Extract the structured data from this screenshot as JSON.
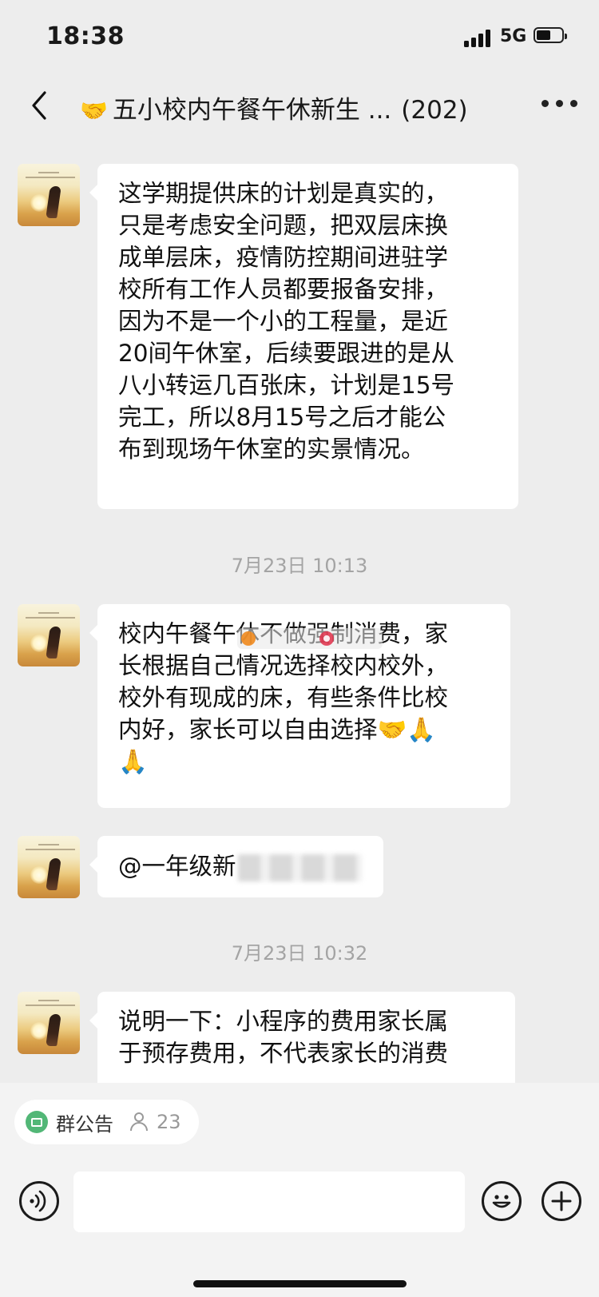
{
  "status_bar": {
    "time": "18:38",
    "network": "5G",
    "battery_percent": 55
  },
  "header": {
    "title": "五小校内午餐午休新生 ...",
    "member_count": "(202)",
    "title_icon": "handshake-emoji"
  },
  "messages": [
    {
      "type": "text",
      "sender": "group-member",
      "lines": [
        "这学期提供床的计划是真实的，",
        "只是考虑安全问题，把双层床换",
        "成单层床，疫情防控期间进驻学",
        "校所有工作人员都要报备安排，",
        "因为不是一个小的工程量，是近",
        "20间午休室，后续要跟进的是从",
        "八小转运几百张床，计划是15号",
        "完工，所以8月15号之后才能公",
        "布到现场午休室的实景情况。"
      ]
    },
    {
      "type": "timestamp",
      "text": "7月23日 10:13"
    },
    {
      "type": "text",
      "sender": "group-member",
      "lines": [
        "校内午餐午休不做强制消费，家",
        "长根据自己情况选择校内校外，",
        "校外有现成的床，有些条件比校",
        "内好，家长可以自由选择🤝🙏",
        "🙏"
      ]
    },
    {
      "type": "text",
      "sender": "group-member",
      "mention_visible": "@一年级新"
    },
    {
      "type": "timestamp",
      "text": "7月23日 10:32"
    },
    {
      "type": "text",
      "sender": "group-member",
      "lines": [
        "说明一下：小程序的费用家长属",
        "于预存费用，不代表家长的消费"
      ]
    }
  ],
  "bottom_bar": {
    "notice_label": "群公告",
    "notice_members": "23",
    "input_placeholder": "",
    "icons": [
      "voice-icon",
      "emoji-icon",
      "plus-icon"
    ]
  },
  "colors": {
    "background": "#ededed",
    "bubble": "#ffffff",
    "timestamp": "#a4a4a4",
    "notice_green": "#52b777"
  }
}
